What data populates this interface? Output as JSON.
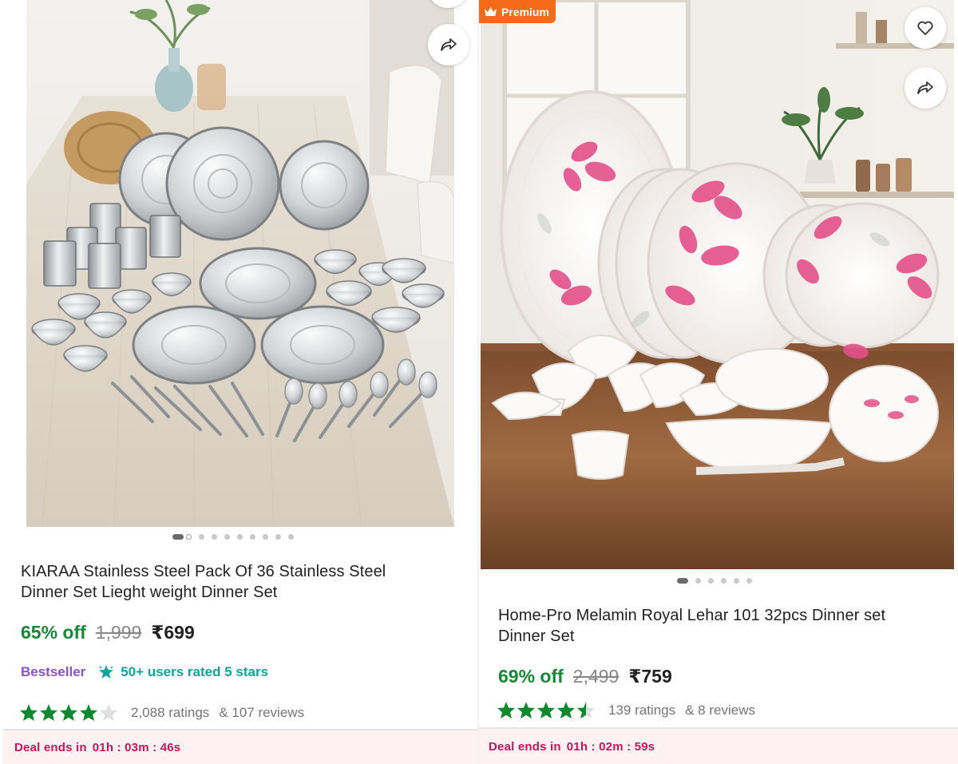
{
  "products": [
    {
      "title_line1": "KIARAA Stainless Steel Pack Of 36 Stainless Steel",
      "title_line2": "Dinner Set Lieght weight Dinner Set",
      "discount": "65% off",
      "mrp": "1,999",
      "price": "₹699",
      "bestseller_label": "Bestseller",
      "users_rated_label": "50+ users rated 5 stars",
      "rating_stars": 4,
      "ratings_text": "2,088 ratings",
      "reviews_text": "& 107 reviews",
      "deal_label": "Deal ends in",
      "deal_timer": "01h : 03m : 46s",
      "image_count": 10,
      "active_image": 0,
      "icons": [
        "share-icon",
        "wishlist-icon"
      ]
    },
    {
      "badge_label": "Premium",
      "title_line1": "Home-Pro Melamin Royal Lehar 101 32pcs Dinner set",
      "title_line2": "Dinner Set",
      "discount": "69% off",
      "mrp": "2,499",
      "price": "₹759",
      "rating_stars": 4.5,
      "ratings_text": "139 ratings",
      "reviews_text": "& 8 reviews",
      "deal_label": "Deal ends in",
      "deal_timer": "01h : 02m : 59s",
      "image_count": 6,
      "active_image": 0,
      "icons": [
        "heart-icon",
        "share-icon",
        "crown-icon"
      ]
    }
  ],
  "colors": {
    "discount": "#138a36",
    "star": "#0e8a2e",
    "bestseller": "#8f4fd1",
    "users_rated": "#0fa4a0",
    "deal_text": "#c2185b",
    "premium_badge": "#f46a19"
  }
}
